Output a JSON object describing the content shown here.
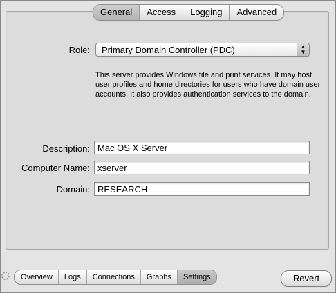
{
  "top_tabs": [
    {
      "label": "General",
      "active": true
    },
    {
      "label": "Access",
      "active": false
    },
    {
      "label": "Logging",
      "active": false
    },
    {
      "label": "Advanced",
      "active": false
    }
  ],
  "role": {
    "label": "Role:",
    "value": "Primary Domain Controller (PDC)",
    "description": "This server provides Windows file and print services.  It may host user profiles and home directories for users who have domain user accounts.  It also provides authentication services to the domain."
  },
  "fields": {
    "description": {
      "label": "Description:",
      "value": "Mac OS X Server"
    },
    "computer_name": {
      "label": "Computer Name:",
      "value": "xserver"
    },
    "domain": {
      "label": "Domain:",
      "value": "RESEARCH"
    }
  },
  "bottom_tabs": [
    {
      "label": "Overview",
      "active": false
    },
    {
      "label": "Logs",
      "active": false
    },
    {
      "label": "Connections",
      "active": false
    },
    {
      "label": "Graphs",
      "active": false
    },
    {
      "label": "Settings",
      "active": true
    }
  ],
  "revert_label": "Revert"
}
